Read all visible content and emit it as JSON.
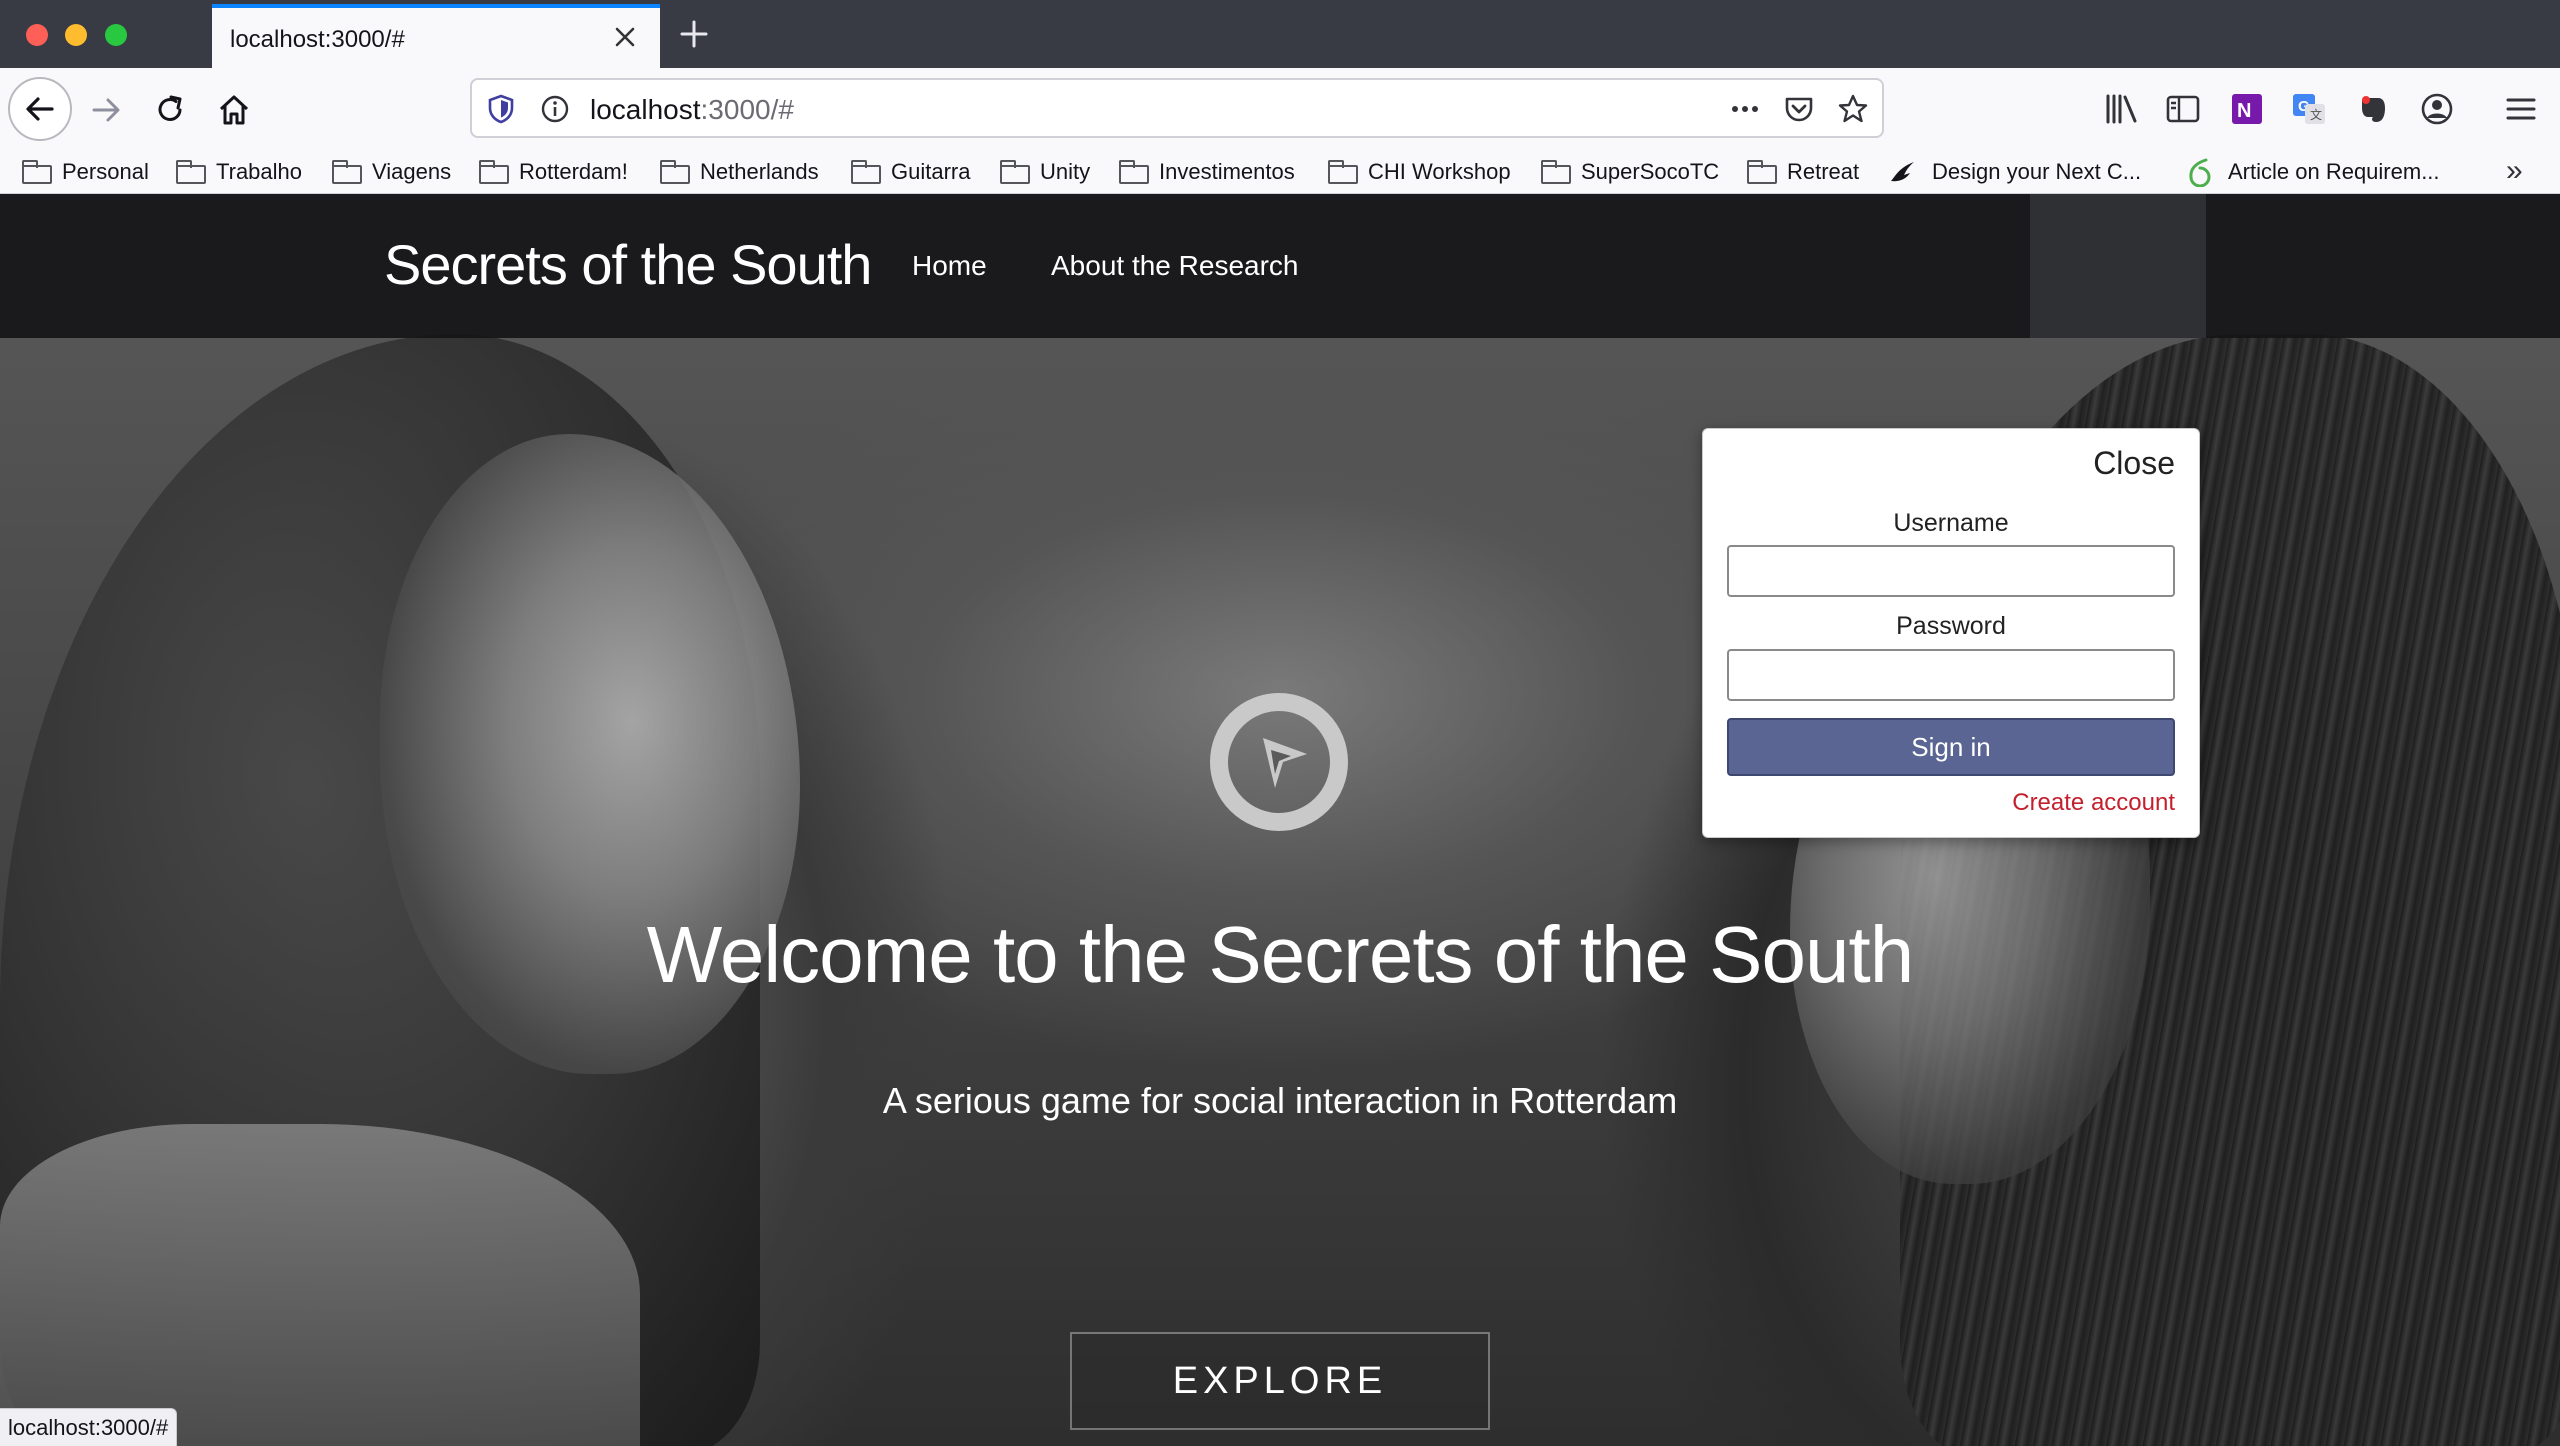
{
  "browser": {
    "tab_title": "localhost:3000/#",
    "url_host": "localhost",
    "url_path": ":3000/#",
    "status_url": "localhost:3000/#",
    "bookmarks": [
      {
        "label": "Personal",
        "icon": "folder-icon"
      },
      {
        "label": "Trabalho",
        "icon": "folder-icon"
      },
      {
        "label": "Viagens",
        "icon": "folder-icon"
      },
      {
        "label": "Rotterdam!",
        "icon": "folder-icon"
      },
      {
        "label": "Netherlands",
        "icon": "folder-icon"
      },
      {
        "label": "Guitarra",
        "icon": "folder-icon"
      },
      {
        "label": "Unity",
        "icon": "folder-icon"
      },
      {
        "label": "Investimentos",
        "icon": "folder-icon"
      },
      {
        "label": "CHI Workshop",
        "icon": "folder-icon"
      },
      {
        "label": "SuperSocoTC",
        "icon": "folder-icon"
      },
      {
        "label": "Retreat",
        "icon": "folder-icon"
      },
      {
        "label": "Design your Next C...",
        "icon": "bird-icon"
      },
      {
        "label": "Article on Requirem...",
        "icon": "overleaf-icon"
      }
    ],
    "colors": {
      "tab_accent": "#0a84ff",
      "chrome_dark": "#383b44"
    }
  },
  "site": {
    "brand": "Secrets of the South",
    "nav": {
      "home": "Home",
      "about": "About the Research"
    },
    "hero_title": "Welcome to the Secrets of the South",
    "hero_subtitle": "A serious game for social interaction in Rotterdam",
    "explore_label": "EXPLORE"
  },
  "login": {
    "close_label": "Close",
    "username_label": "Username",
    "username_value": "",
    "password_label": "Password",
    "password_value": "",
    "signin_label": "Sign in",
    "create_account_label": "Create account",
    "colors": {
      "signin_bg": "#5a6593",
      "create_link": "#c31f2d"
    }
  }
}
